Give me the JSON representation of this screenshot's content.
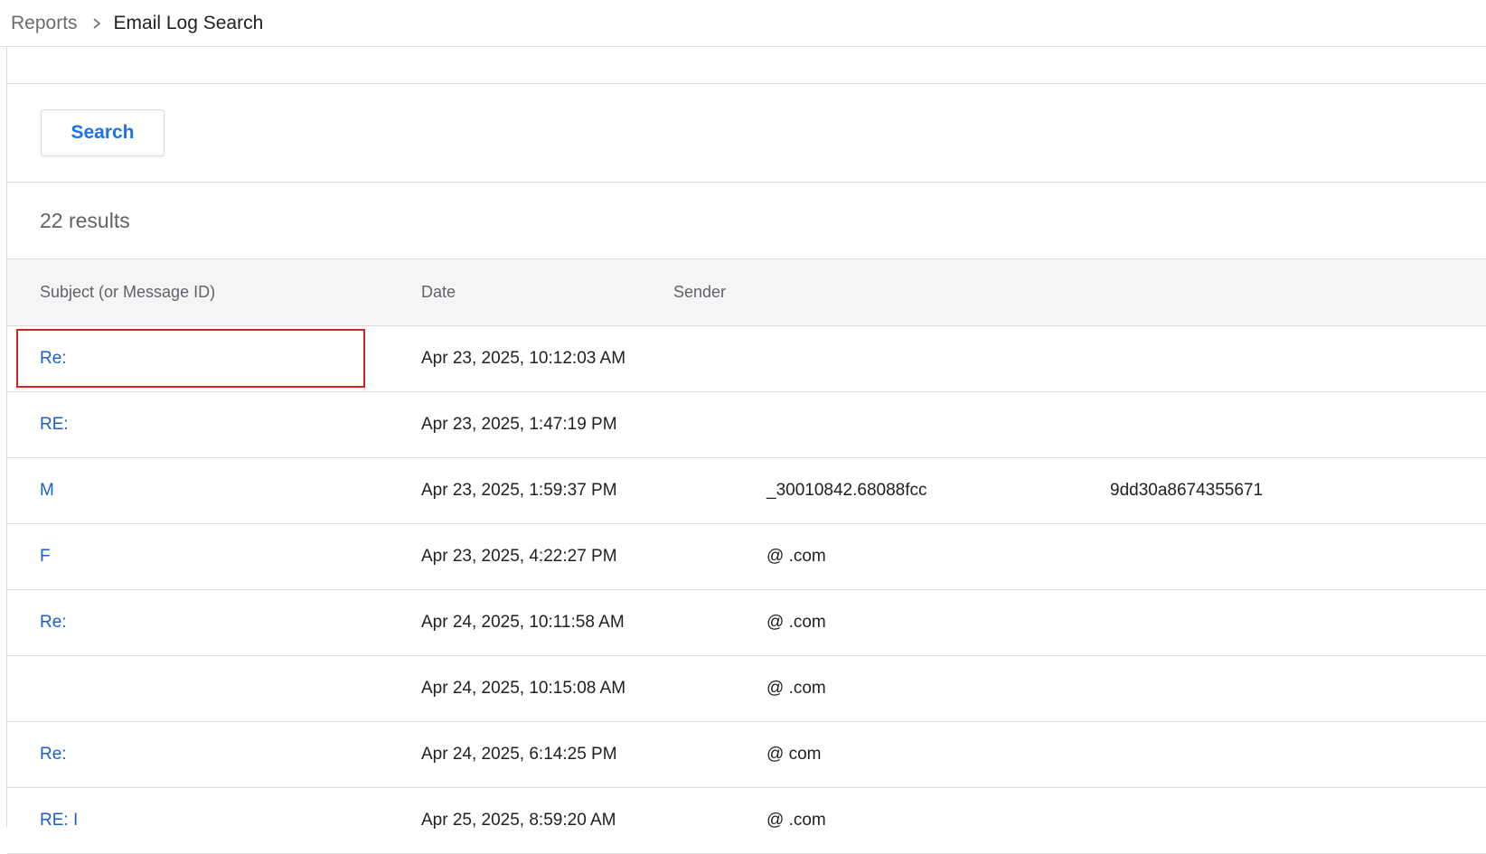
{
  "breadcrumb": {
    "parent": "Reports",
    "current": "Email Log Search"
  },
  "search": {
    "button_label": "Search"
  },
  "results": {
    "count_label": "22 results"
  },
  "table": {
    "columns": {
      "subject": "Subject (or Message ID)",
      "date": "Date",
      "sender": "Sender"
    },
    "rows": [
      {
        "subject": "Re:",
        "date": "Apr 23, 2025, 10:12:03 AM",
        "sender": "",
        "extra": ""
      },
      {
        "subject": "RE:",
        "date": "Apr 23, 2025, 1:47:19 PM",
        "sender": "",
        "extra": ""
      },
      {
        "subject": "M",
        "date": "Apr 23, 2025, 1:59:37 PM",
        "sender": "_30010842.68088fcc",
        "extra": "9dd30a8674355671"
      },
      {
        "subject": "F",
        "date": "Apr 23, 2025, 4:22:27 PM",
        "sender": "@ .com",
        "extra": ""
      },
      {
        "subject": "Re:",
        "date": "Apr 24, 2025, 10:11:58 AM",
        "sender": "@ .com",
        "extra": ""
      },
      {
        "subject": "",
        "date": "Apr 24, 2025, 10:15:08 AM",
        "sender": "@ .com",
        "extra": ""
      },
      {
        "subject": "Re:",
        "date": "Apr 24, 2025, 6:14:25 PM",
        "sender": "@ com",
        "extra": ""
      },
      {
        "subject": "RE: I",
        "date": "Apr 25, 2025, 8:59:20 AM",
        "sender": "@ .com",
        "extra": ""
      }
    ]
  },
  "colors": {
    "link": "#1a5fcc",
    "accent": "#1a73e8",
    "highlight": "#e02020",
    "header_bg": "#f5f5f5"
  },
  "icons": {
    "breadcrumb_separator": "chevron-right-icon"
  }
}
